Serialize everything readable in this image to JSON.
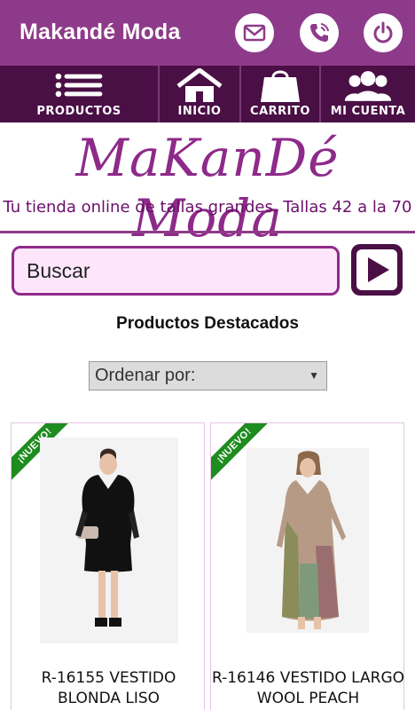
{
  "app": {
    "title": "Makandé Moda"
  },
  "top_actions": [
    "mail-icon",
    "phone-icon",
    "power-icon"
  ],
  "nav": {
    "items": [
      {
        "label": "PRODUCTOS",
        "icon": "menu-icon"
      },
      {
        "label": "INICIO",
        "icon": "home-icon"
      },
      {
        "label": "CARRITO",
        "icon": "bag-icon"
      },
      {
        "label": "MI CUENTA",
        "icon": "users-icon"
      }
    ]
  },
  "banner": {
    "logo": "MaKanDé Moda",
    "tagline": "Tu tienda online de tallas grandes. Tallas 42 a la 70"
  },
  "search": {
    "placeholder": "Buscar"
  },
  "featured": {
    "title": "Productos Destacados",
    "sort_label": "Ordenar por:"
  },
  "products": [
    {
      "ribbon": "¡NUEVO!",
      "name_line1": "R-16155 VESTIDO",
      "name_line2": "BLONDA LISO"
    },
    {
      "ribbon": "¡NUEVO!",
      "name_line1": "R-16146 VESTIDO LARGO",
      "name_line2": "WOOL PEACH"
    }
  ],
  "colors": {
    "appbar": "#8e3a8a",
    "navbar": "#4a0f45",
    "brand": "#8e2a8a",
    "ribbon": "#1e8c1e"
  }
}
